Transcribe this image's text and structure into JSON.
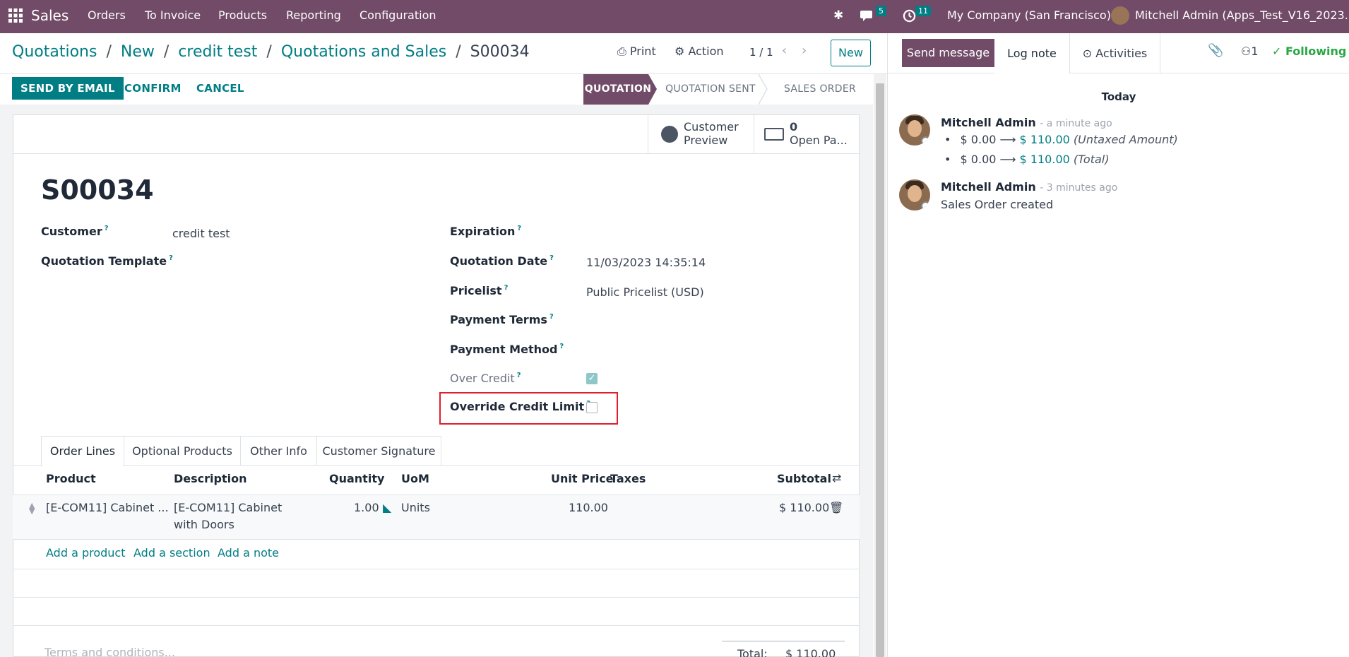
{
  "navbar": {
    "app_name": "Sales",
    "menu": [
      "Orders",
      "To Invoice",
      "Products",
      "Reporting",
      "Configuration"
    ],
    "messages_count": "5",
    "activities_count": "11",
    "company": "My Company (San Francisco)",
    "user": "Mitchell Admin (Apps_Test_V16_2023..."
  },
  "breadcrumb": {
    "items": [
      "Quotations",
      "New",
      "credit test",
      "Quotations and Sales"
    ],
    "current": "S00034",
    "sep": "/"
  },
  "control": {
    "print_label": "Print",
    "action_label": "Action",
    "pager": "1 / 1",
    "new_label": "New"
  },
  "statusbar": {
    "send_email": "SEND BY EMAIL",
    "confirm": "CONFIRM",
    "cancel": "CANCEL",
    "stages": [
      "QUOTATION",
      "QUOTATION SENT",
      "SALES ORDER"
    ],
    "active_stage": "QUOTATION"
  },
  "smart_buttons": {
    "preview_line1": "Customer",
    "preview_line2": "Preview",
    "payments_count": "0",
    "payments_label": "Open Pa..."
  },
  "form": {
    "name": "S00034",
    "customer_label": "Customer",
    "customer_value": "credit test",
    "template_label": "Quotation Template",
    "expiration_label": "Expiration",
    "quotation_date_label": "Quotation Date",
    "quotation_date_value": "11/03/2023 14:35:14",
    "pricelist_label": "Pricelist",
    "pricelist_value": "Public Pricelist (USD)",
    "payment_terms_label": "Payment Terms",
    "payment_method_label": "Payment Method",
    "over_credit_label": "Over Credit",
    "over_credit_checked": true,
    "override_label": "Override Credit Limit",
    "override_checked": false,
    "help_mark": "?"
  },
  "tabs": [
    "Order Lines",
    "Optional Products",
    "Other Info",
    "Customer Signature"
  ],
  "lines": {
    "headers": {
      "product": "Product",
      "description": "Description",
      "quantity": "Quantity",
      "uom": "UoM",
      "unit_price": "Unit Price",
      "taxes": "Taxes",
      "subtotal": "Subtotal"
    },
    "rows": [
      {
        "product": "[E-COM11] Cabinet ...",
        "description_1": "[E-COM11] Cabinet",
        "description_2": "with Doors",
        "quantity": "1.00",
        "uom": "Units",
        "unit_price": "110.00",
        "subtotal": "$ 110.00"
      }
    ],
    "add_product": "Add a product",
    "add_section": "Add a section",
    "add_note": "Add a note"
  },
  "footer": {
    "terms_placeholder": "Terms and conditions...",
    "total_label": "Total:",
    "total_value": "$ 110.00"
  },
  "chatter": {
    "send_message": "Send message",
    "log_note": "Log note",
    "activities": "Activities",
    "followers_count": "1",
    "following": "Following",
    "today": "Today",
    "messages": [
      {
        "author": "Mitchell Admin",
        "time": "- a minute ago",
        "changes": [
          {
            "old": "$ 0.00",
            "new": "$ 110.00",
            "field": "(Untaxed Amount)"
          },
          {
            "old": "$ 0.00",
            "new": "$ 110.00",
            "field": "(Total)"
          }
        ]
      },
      {
        "author": "Mitchell Admin",
        "time": "- 3 minutes ago",
        "body": "Sales Order created"
      }
    ]
  },
  "colors": {
    "brand": "#714b67",
    "accent": "#017e84",
    "highlight_box": "#e11d2e"
  }
}
